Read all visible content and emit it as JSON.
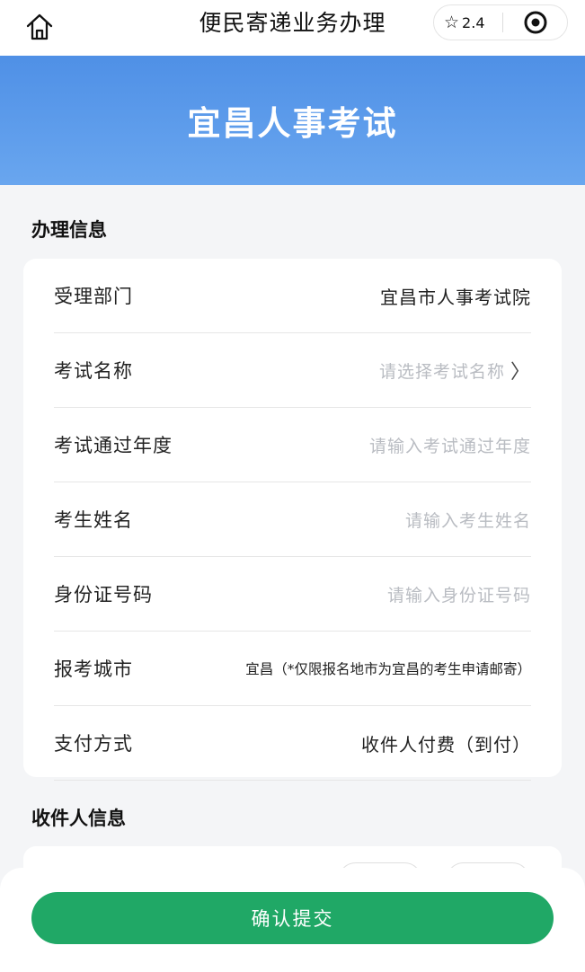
{
  "nav": {
    "title": "便民寄递业务办理",
    "rating": "2.4",
    "icons": [
      "home-icon",
      "star-icon",
      "target-icon"
    ]
  },
  "banner": {
    "title": "宜昌人事考试"
  },
  "section_handling": {
    "title": "办理信息",
    "rows": [
      {
        "label": "受理部门",
        "value": "宜昌市人事考试院"
      },
      {
        "label": "考试名称",
        "placeholder": "请选择考试名称"
      },
      {
        "label": "考试通过年度",
        "placeholder": "请输入考试通过年度"
      },
      {
        "label": "考生姓名",
        "placeholder": "请输入考生姓名"
      },
      {
        "label": "身份证号码",
        "placeholder": "请输入身份证号码"
      },
      {
        "label": "报考城市",
        "value": "宜昌（*仅限报名地市为宜昌的考生申请邮寄）"
      },
      {
        "label": "支付方式",
        "value": "收件人付费（到付）"
      }
    ]
  },
  "section_recipient": {
    "title": "收件人信息"
  },
  "submit": {
    "label": "确认提交",
    "color": "#20a866"
  },
  "colors": {
    "banner_top": "#4f90e6",
    "banner_bottom": "#69a6ef",
    "placeholder": "#b9bcc2"
  }
}
